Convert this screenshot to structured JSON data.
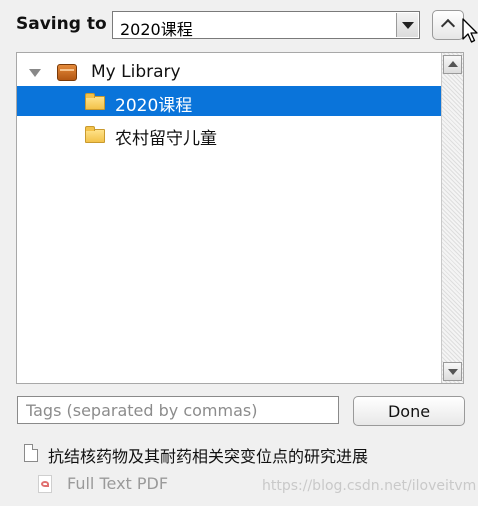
{
  "saving": {
    "label": "Saving to",
    "selected_collection": "2020课程"
  },
  "tree": {
    "items": [
      {
        "label": "My Library",
        "icon": "library-icon",
        "expanded": true,
        "selected": false
      },
      {
        "label": "2020课程",
        "icon": "folder-icon",
        "selected": true
      },
      {
        "label": "农村留守儿童",
        "icon": "folder-icon",
        "selected": false
      }
    ]
  },
  "tags": {
    "placeholder": "Tags (separated by commas)",
    "value": ""
  },
  "done_label": "Done",
  "item": {
    "title": "抗结核药物及其耐药相关突变位点的研究进展",
    "attachment": "Full Text PDF"
  },
  "watermark": "https://blog.csdn.net/iloveitvm",
  "colors": {
    "selection": "#0a74da",
    "background": "#f0f0f0",
    "attachment_text": "#9a9a9a"
  }
}
